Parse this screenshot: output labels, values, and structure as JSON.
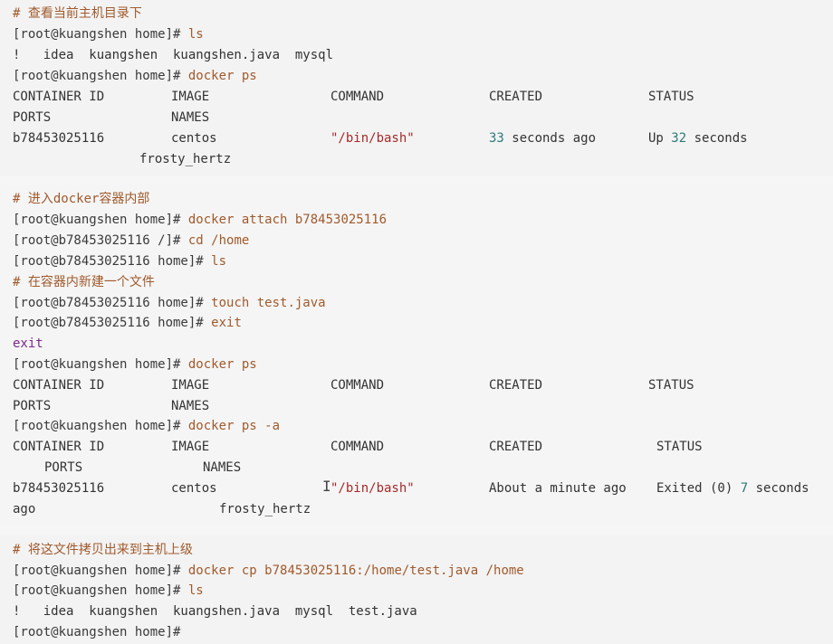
{
  "colors": {
    "comment": "#a05a2c",
    "keyword": "#a05a2c",
    "string": "#a52a2a",
    "number": "#2c7a7a",
    "exit": "#7a2a8a"
  },
  "lines": {
    "l1": "# 查看当前主机目录下",
    "l2p": "[root@kuangshen home]# ",
    "l2c": "ls",
    "l3": "!   idea  kuangshen  kuangshen.java  mysql",
    "l4p": "[root@kuangshen home]# ",
    "l4c": "docker ps",
    "h1": {
      "id": "CONTAINER ID",
      "image": "IMAGE",
      "command": "COMMAND",
      "created": "CREATED",
      "status": "STATUS"
    },
    "h1b": {
      "ports": "PORTS",
      "names": "NAMES"
    },
    "r1": {
      "id": "b78453025116",
      "image": "centos",
      "command": "\"/bin/bash\"",
      "created_num": "33",
      "created_rest": " seconds ago",
      "status_pre": "Up ",
      "status_num": "32",
      "status_rest": " seconds"
    },
    "r1b": {
      "names": "frosty_hertz"
    },
    "l9": "# 进入docker容器内部",
    "l10p": "[root@kuangshen home]# ",
    "l10c": "docker attach b78453025116",
    "l11p": "[root@b78453025116 /]# ",
    "l11c": "cd /home",
    "l12p": "[root@b78453025116 home]# ",
    "l12c": "ls",
    "l13": "# 在容器内新建一个文件",
    "l14p": "[root@b78453025116 home]# ",
    "l14c": "touch test.java",
    "l15p": "[root@b78453025116 home]# ",
    "l15c": "exit",
    "l16": "exit",
    "l17p": "[root@kuangshen home]# ",
    "l17c": "docker ps",
    "h2": {
      "id": "CONTAINER ID",
      "image": "IMAGE",
      "command": "COMMAND",
      "created": "CREATED",
      "status": "STATUS"
    },
    "h2b": {
      "ports": "PORTS",
      "names": "NAMES"
    },
    "l20p": "[root@kuangshen home]# ",
    "l20c": "docker ps -a",
    "h3": {
      "id": "CONTAINER ID",
      "image": "IMAGE",
      "command": "COMMAND",
      "created": "CREATED",
      "status": "STATUS"
    },
    "h3b": {
      "ports": "PORTS",
      "names": "NAMES"
    },
    "r3": {
      "id": "b78453025116",
      "image": "centos",
      "command": "\"/bin/bash\"",
      "created": "About a minute ago",
      "status_pre": "Exited (0) ",
      "status_num": "7",
      "status_rest": " seconds"
    },
    "r3b": {
      "ago": "ago",
      "names": "frosty_hertz"
    },
    "l25": "# 将这文件拷贝出来到主机上级",
    "l26p": "[root@kuangshen home]# ",
    "l26c": "docker cp b78453025116:/home/test.java /home",
    "l27p": "[root@kuangshen home]# ",
    "l27c": "ls",
    "l28": "!   idea  kuangshen  kuangshen.java  mysql  test.java",
    "l29p": "[root@kuangshen home]#"
  },
  "cursor_glyph": "I"
}
